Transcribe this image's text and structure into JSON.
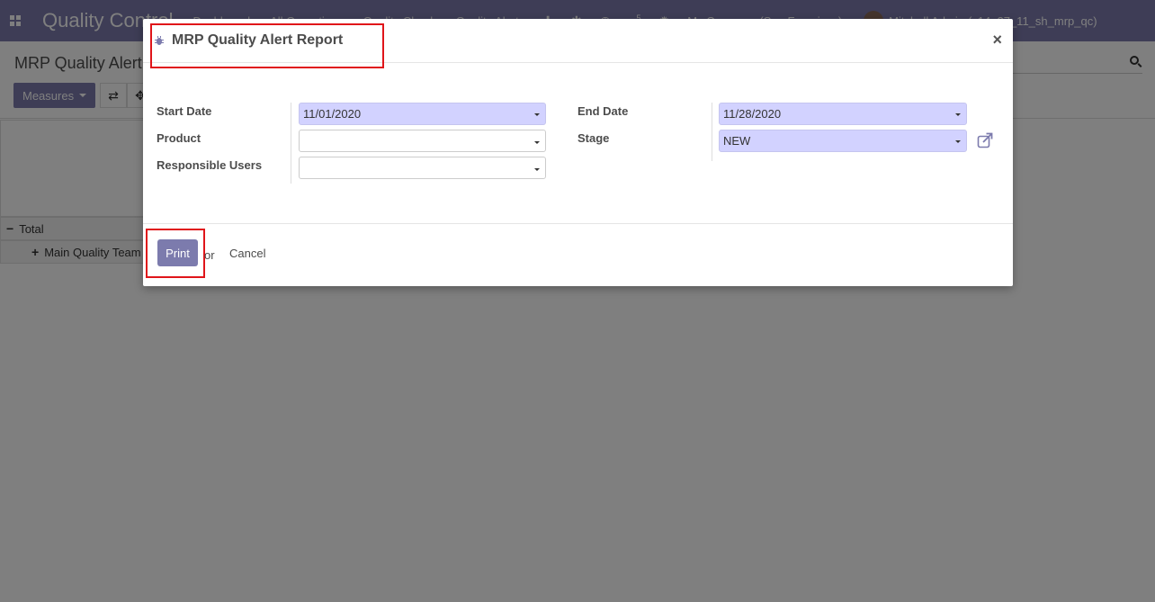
{
  "navbar": {
    "app_title": "Quality Control",
    "menu": [
      "Dashboard",
      "All Operations",
      "Quality Check",
      "Quality Alerts"
    ],
    "chat_count": "5",
    "company": "My Company (San Francisco)",
    "user": "Mitchell Admin",
    "db": "(v14_27_11_sh_mrp_qc)"
  },
  "control_panel": {
    "breadcrumb": "MRP Quality Alert",
    "measures_label": "Measures"
  },
  "pivot": {
    "total_label": "Total",
    "team_label": "Main Quality Team"
  },
  "modal": {
    "title": "MRP Quality Alert Report",
    "close_glyph": "×",
    "fields": {
      "start_date": {
        "label": "Start Date",
        "value": "11/01/2020"
      },
      "product": {
        "label": "Product",
        "value": ""
      },
      "responsible_users": {
        "label": "Responsible Users",
        "value": ""
      },
      "end_date": {
        "label": "End Date",
        "value": "11/28/2020"
      },
      "stage": {
        "label": "Stage",
        "value": "NEW"
      }
    },
    "footer": {
      "print_label": "Print",
      "or_text": "or",
      "cancel_label": "Cancel"
    }
  },
  "colors": {
    "brand": "#7c7bad",
    "required_field": "#d2d2ff",
    "highlight": "#e0151a"
  }
}
